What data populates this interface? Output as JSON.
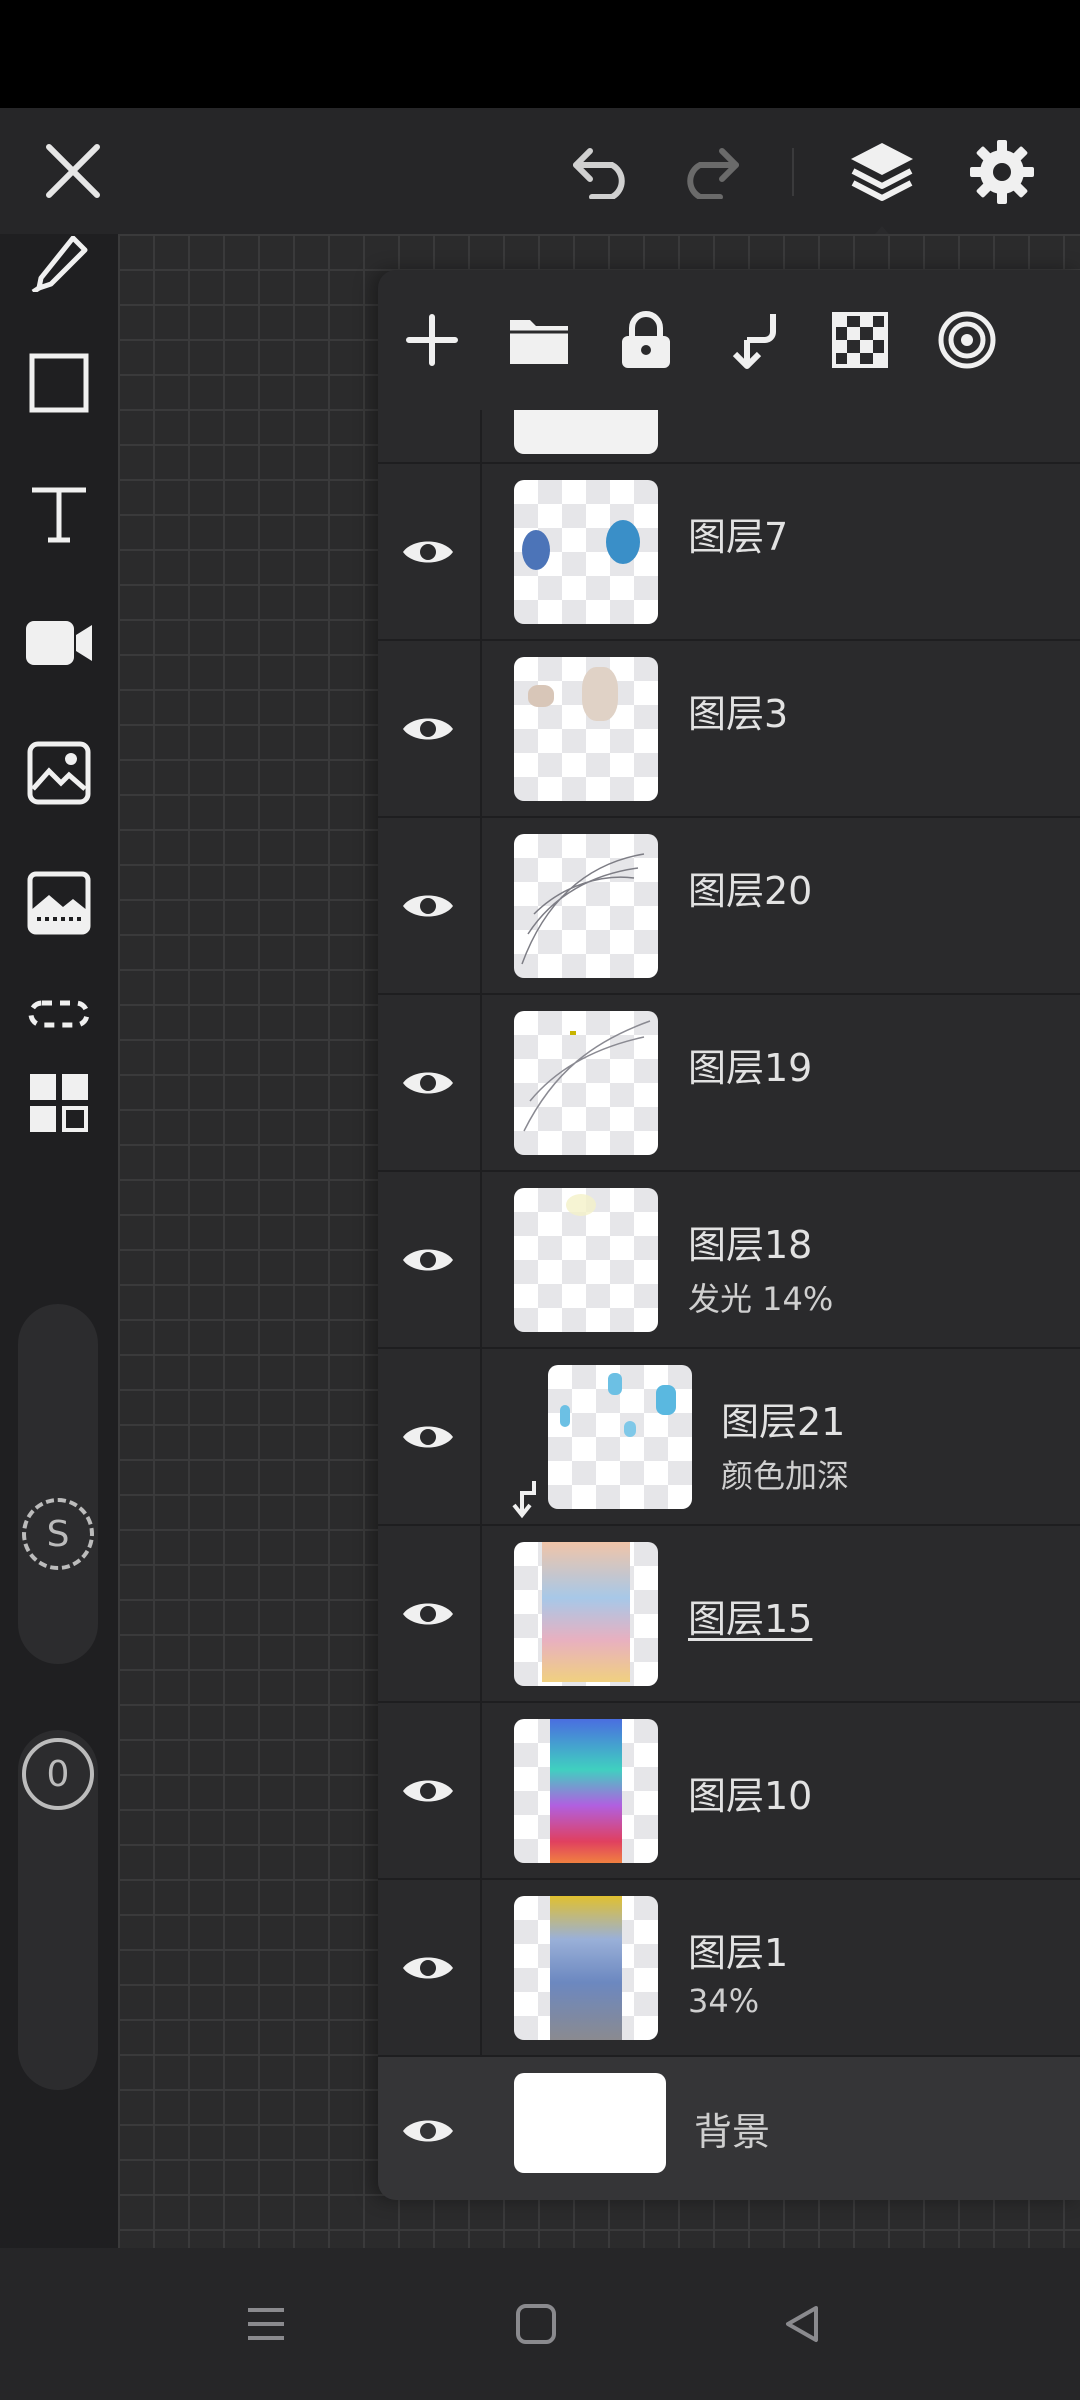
{
  "topbar": {
    "close_icon": "close-icon",
    "undo_icon": "undo-icon",
    "redo_icon": "redo-icon",
    "layers_icon": "layers-icon",
    "settings_icon": "gear-icon"
  },
  "left_toolbar": {
    "tools": [
      "eyedropper-icon",
      "rectangle-icon",
      "text-icon",
      "video-camera-icon",
      "image-import-icon",
      "image-frame-icon",
      "dotted-selection-icon",
      "grid-icon"
    ],
    "brush_size_badge": "S",
    "opacity_badge": "0"
  },
  "layer_panel": {
    "tools": [
      "add-icon",
      "folder-icon",
      "lock-icon",
      "merge-down-icon",
      "checker-icon",
      "target-icon"
    ],
    "layers": [
      {
        "name": "图层7",
        "sub": ""
      },
      {
        "name": "图层3",
        "sub": ""
      },
      {
        "name": "图层20",
        "sub": ""
      },
      {
        "name": "图层19",
        "sub": ""
      },
      {
        "name": "图层18",
        "sub": "发光   14%"
      },
      {
        "name": "图层21",
        "sub": "颜色加深"
      },
      {
        "name": "图层15",
        "sub": ""
      },
      {
        "name": "图层10",
        "sub": ""
      },
      {
        "name": "图层1",
        "sub": "34%"
      }
    ],
    "background_label": "背景"
  },
  "navbar": {
    "menu_icon": "recent-apps-icon",
    "home_icon": "home-icon",
    "back_icon": "back-icon"
  }
}
